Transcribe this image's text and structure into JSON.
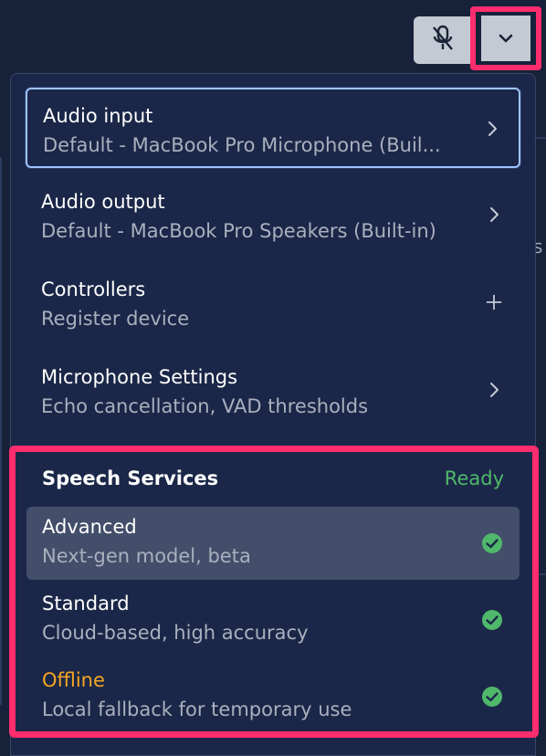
{
  "toolbar": {
    "mic_icon": "mic-off-icon",
    "dropdown_icon": "chevron-down-icon"
  },
  "menu": {
    "items": [
      {
        "title": "Audio input",
        "subtitle": "Default - MacBook Pro Microphone (Buil...",
        "icon": "chevron-right-icon",
        "focused": true
      },
      {
        "title": "Audio output",
        "subtitle": "Default - MacBook Pro Speakers (Built-in)",
        "icon": "chevron-right-icon"
      },
      {
        "title": "Controllers",
        "subtitle": "Register device",
        "icon": "plus-icon"
      },
      {
        "title": "Microphone Settings",
        "subtitle": "Echo cancellation, VAD thresholds",
        "icon": "chevron-right-icon"
      }
    ]
  },
  "speech": {
    "title": "Speech Services",
    "status": "Ready",
    "status_color": "#4fb86b",
    "options": [
      {
        "title": "Advanced",
        "subtitle": "Next-gen model, beta",
        "selected": true,
        "icon": "check-circle-icon"
      },
      {
        "title": "Standard",
        "subtitle": "Cloud-based, high accuracy",
        "icon": "check-circle-icon"
      },
      {
        "title": "Offline",
        "subtitle": "Local fallback for temporary use",
        "title_color": "#f5a623",
        "icon": "check-circle-icon"
      }
    ]
  },
  "colors": {
    "highlight": "#ff2d6e",
    "panel": "#1b2748",
    "check": "#4fb86b"
  }
}
